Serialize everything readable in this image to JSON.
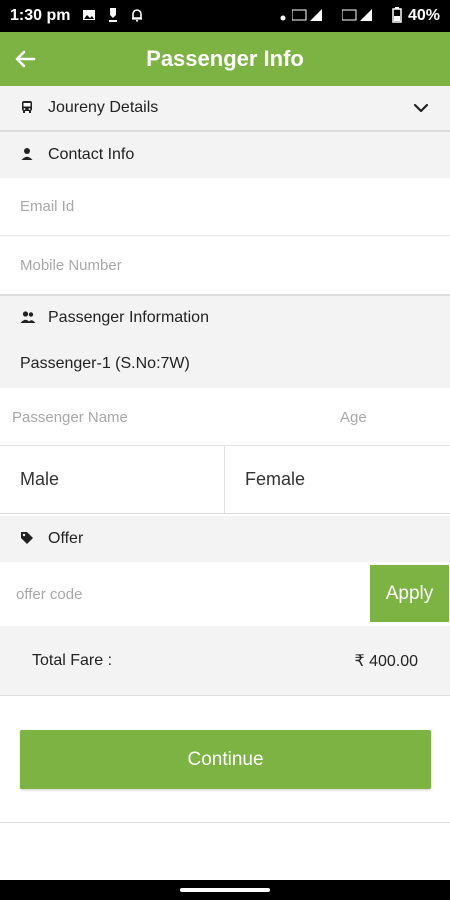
{
  "status_bar": {
    "time": "1:30 pm",
    "icons": [
      "image-icon",
      "mirror-icon",
      "notification-bell-icon"
    ],
    "mirror_label": "",
    "right_icons": [
      "dot-icon",
      "volte-signal-icon",
      "battery-icon"
    ],
    "battery": "40%"
  },
  "app_bar": {
    "title": "Passenger Info",
    "back_icon": "back-arrow-icon"
  },
  "sections": {
    "journey": {
      "label": "Joureny Details",
      "icon": "bus-icon",
      "chevron": "chevron-down-icon"
    },
    "contact": {
      "label": "Contact Info",
      "icon": "person-icon"
    },
    "passenger": {
      "label": "Passenger Information",
      "icon": "people-icon"
    },
    "offer": {
      "label": "Offer",
      "icon": "tag-icon"
    }
  },
  "contact_form": {
    "email_placeholder": "Email Id",
    "mobile_placeholder": "Mobile Number"
  },
  "passenger": {
    "title": "Passenger-1 (S.No:7W)",
    "name_placeholder": "Passenger Name",
    "age_placeholder": "Age",
    "gender_options": [
      "Male",
      "Female"
    ]
  },
  "offer": {
    "code_placeholder": "offer code",
    "apply_label": "Apply"
  },
  "fare": {
    "label": "Total Fare :",
    "amount": "₹ 400.00"
  },
  "actions": {
    "continue_label": "Continue"
  },
  "colors": {
    "accent": "#7cb342",
    "section_bg": "#f3f3f3"
  }
}
